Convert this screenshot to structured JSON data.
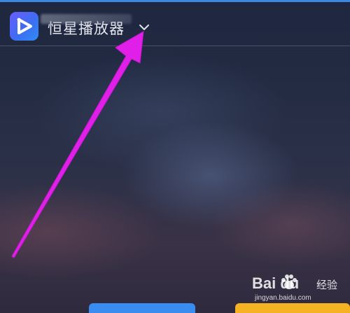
{
  "window": {
    "title": "恒星播放器",
    "logo_icon": "play-logo-icon",
    "dropdown_icon": "chevron-down-icon",
    "accent": "#3c87e0"
  },
  "annotation": {
    "arrow_color": "#e020e8",
    "points_to": "title-dropdown"
  },
  "bottom_buttons": [
    {
      "color": "#3a8df0"
    },
    {
      "color": "#f5b324"
    }
  ],
  "watermark": {
    "brand": "Bai du",
    "service": "经验",
    "url": "jingyan.baidu.com"
  }
}
